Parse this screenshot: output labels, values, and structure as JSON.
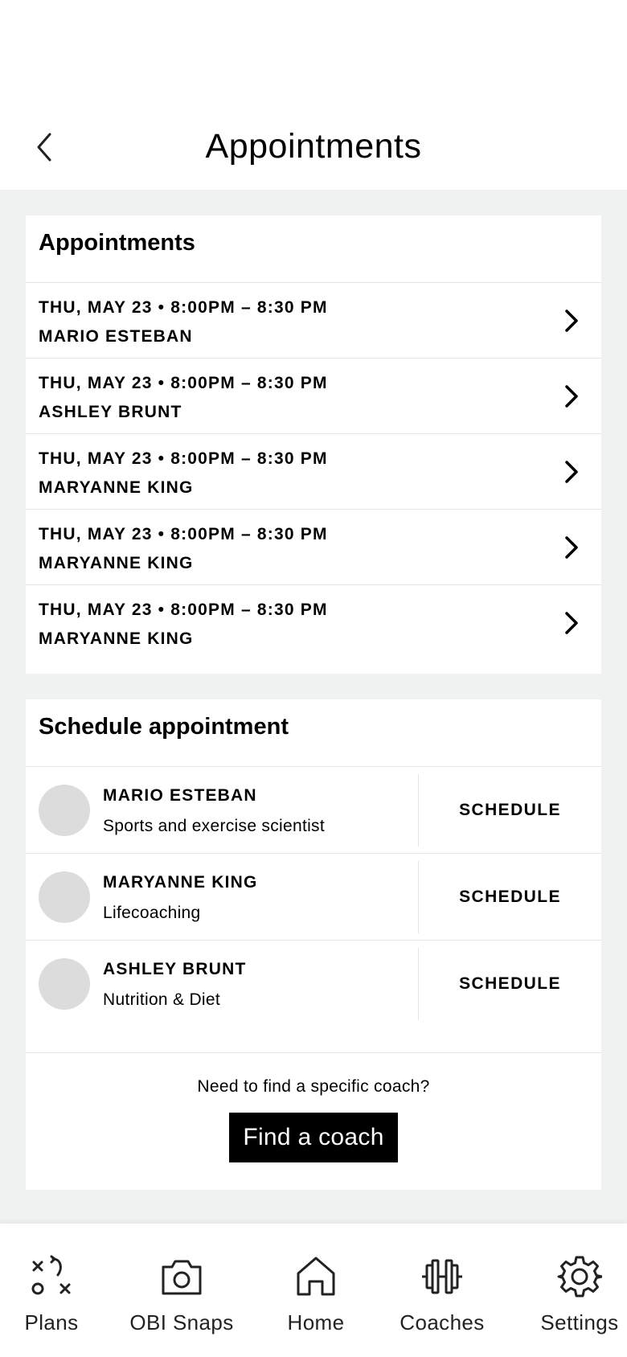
{
  "header": {
    "title": "Appointments"
  },
  "appointments": {
    "title": "Appointments",
    "items": [
      {
        "datetime": "THU, MAY 23 • 8:00PM – 8:30 PM",
        "coach": "MARIO ESTEBAN"
      },
      {
        "datetime": "THU, MAY 23 • 8:00PM – 8:30 PM",
        "coach": "ASHLEY BRUNT"
      },
      {
        "datetime": "THU, MAY 23 • 8:00PM – 8:30 PM",
        "coach": "MARYANNE KING"
      },
      {
        "datetime": "THU, MAY 23 • 8:00PM – 8:30 PM",
        "coach": "MARYANNE KING"
      },
      {
        "datetime": "THU, MAY 23 • 8:00PM – 8:30 PM",
        "coach": "MARYANNE KING"
      }
    ]
  },
  "schedule": {
    "title": "Schedule appointment",
    "coaches": [
      {
        "name": "MARIO ESTEBAN",
        "role": "Sports and exercise scientist",
        "button": "SCHEDULE"
      },
      {
        "name": "MARYANNE KING",
        "role": "Lifecoaching",
        "button": "SCHEDULE"
      },
      {
        "name": "ASHLEY BRUNT",
        "role": "Nutrition & Diet",
        "button": "SCHEDULE"
      }
    ],
    "find_prompt": "Need to find a specific coach?",
    "find_button": "Find a coach"
  },
  "nav": {
    "items": [
      {
        "label": "Plans",
        "icon": "plays-icon"
      },
      {
        "label": "OBI Snaps",
        "icon": "camera-icon"
      },
      {
        "label": "Home",
        "icon": "home-icon"
      },
      {
        "label": "Coaches",
        "icon": "dumbbell-icon"
      },
      {
        "label": "Settings",
        "icon": "gear-icon"
      }
    ]
  }
}
